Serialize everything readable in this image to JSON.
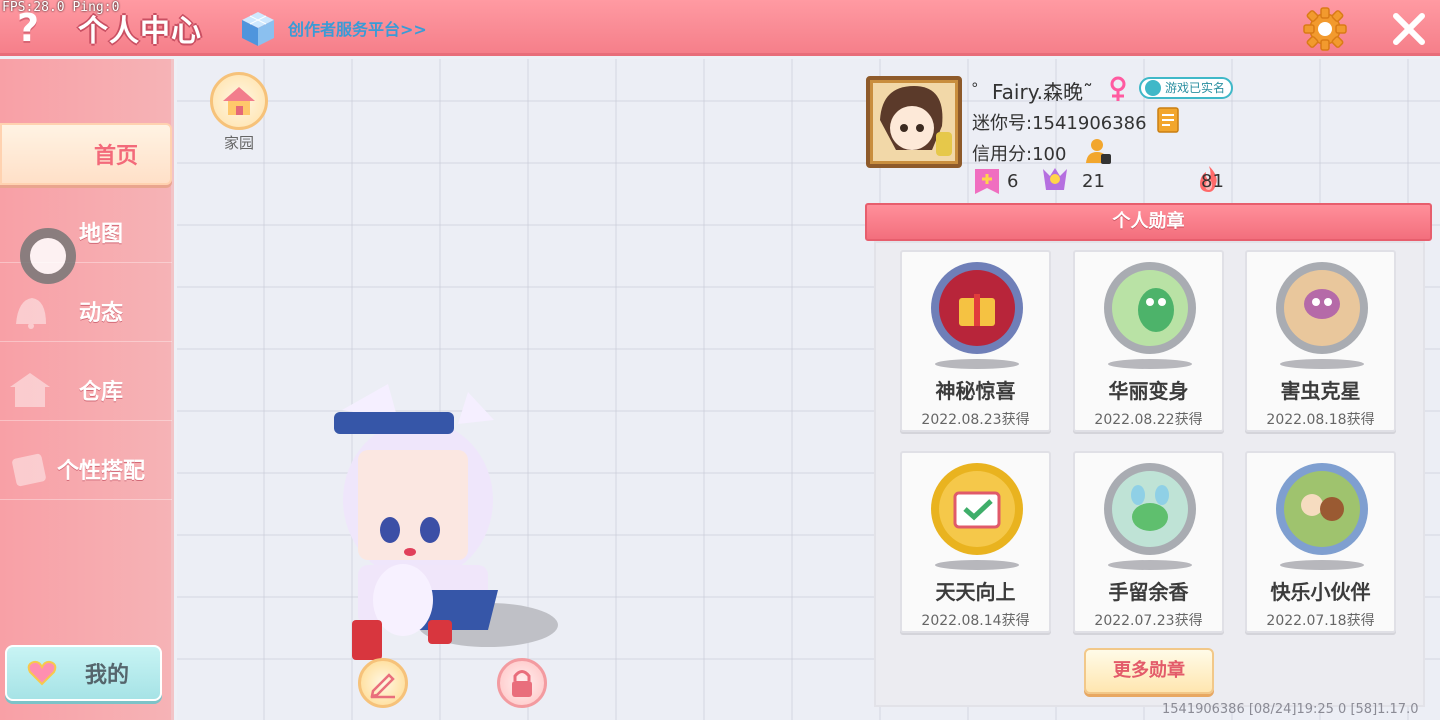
{
  "debug": {
    "fps_text": "FPS:28.0  Ping:0"
  },
  "header": {
    "help_label": "?",
    "title": "个人中心",
    "creator_link": "创作者服务平台>>"
  },
  "sidebar": {
    "items": [
      {
        "label": "首页",
        "active": true
      },
      {
        "label": "地图"
      },
      {
        "label": "动态"
      },
      {
        "label": "仓库"
      },
      {
        "label": "个性搭配"
      }
    ],
    "mine_label": "我的"
  },
  "main": {
    "home_label": "家园"
  },
  "profile": {
    "nickname": "゜Fairy.森晚˜",
    "verified": "游戏已实名",
    "mini_id": "迷你号:1541906386",
    "credit": "信用分:100",
    "stats": [
      {
        "icon": "pink-plus-flag-icon",
        "value": "6"
      },
      {
        "icon": "trophy-person-icon",
        "value": "21"
      },
      {
        "icon": "flame-icon",
        "value": "81"
      }
    ]
  },
  "medals": {
    "header": "个人勋章",
    "items": [
      {
        "name": "神秘惊喜",
        "date": "2022.08.23获得",
        "ring": "#6f7fb8",
        "inner": "#b8253a",
        "icon": "gift-medal-icon"
      },
      {
        "name": "华丽变身",
        "date": "2022.08.22获得",
        "ring": "#a9acb2",
        "inner": "#b9e2a5",
        "icon": "dino-medal-icon"
      },
      {
        "name": "害虫克星",
        "date": "2022.08.18获得",
        "ring": "#a9acb2",
        "inner": "#b56aa8",
        "icon": "bug-medal-icon"
      },
      {
        "name": "天天向上",
        "date": "2022.08.14获得",
        "ring": "#e9b31f",
        "inner": "#f5c84a",
        "icon": "calendar-medal-icon"
      },
      {
        "name": "手留余香",
        "date": "2022.07.23获得",
        "ring": "#a9acb2",
        "inner": "#7fc7a8",
        "icon": "flower-medal-icon"
      },
      {
        "name": "快乐小伙伴",
        "date": "2022.07.18获得",
        "ring": "#7f9fd0",
        "inner": "#9fc36e",
        "icon": "friends-medal-icon"
      }
    ],
    "more_label": "更多勋章"
  },
  "footer": {
    "info": "1541906386     [08/24]19:25 0   [58]1.17.0"
  }
}
